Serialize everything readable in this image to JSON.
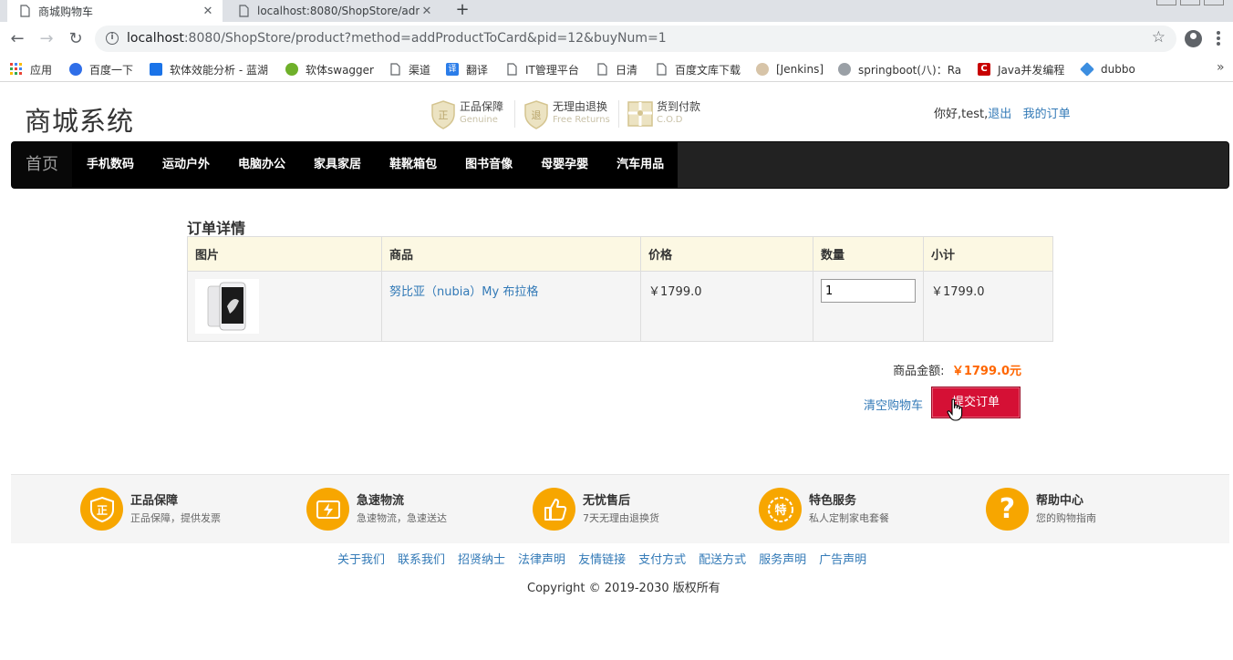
{
  "browser": {
    "tabs": [
      {
        "title": "商城购物车",
        "active": true
      },
      {
        "title": "localhost:8080/ShopStore/adn",
        "active": false
      }
    ],
    "url_host": "localhost",
    "url_rest": ":8080/ShopStore/product?method=addProductToCard&pid=12&buyNum=1",
    "bookmarks": [
      {
        "label": "应用",
        "icon": "apps-grid-icon",
        "color": "#e94235"
      },
      {
        "label": "百度一下",
        "icon": "baidu-paw-icon",
        "color": "#2f6ee8"
      },
      {
        "label": "软体效能分析 - 蓝湖",
        "icon": "lanhu-icon",
        "color": "#1a73e8"
      },
      {
        "label": "软体swagger",
        "icon": "swagger-icon",
        "color": "#6fb02a"
      },
      {
        "label": "渠道",
        "icon": "page-icon",
        "color": "#ffffff"
      },
      {
        "label": "翻译",
        "icon": "translate-icon",
        "color": "#2b7de9"
      },
      {
        "label": "IT管理平台",
        "icon": "page-icon",
        "color": "#ffffff"
      },
      {
        "label": "日清",
        "icon": "page-icon",
        "color": "#ffffff"
      },
      {
        "label": "百度文库下载",
        "icon": "page-icon",
        "color": "#ffffff"
      },
      {
        "label": "[Jenkins]",
        "icon": "jenkins-icon",
        "color": "#d7c4a8"
      },
      {
        "label": "springboot(八)：Ra",
        "icon": "blog-icon",
        "color": "#9aa0a6"
      },
      {
        "label": "Java并发编程",
        "icon": "csdn-icon",
        "color": "#c80000"
      },
      {
        "label": "dubbo",
        "icon": "dubbo-icon",
        "color": "#3c8ee0"
      }
    ],
    "bookmarks_more": "»"
  },
  "header": {
    "logo": "商城系统",
    "promises": [
      {
        "title": "正品保障",
        "sub": "Genuine",
        "icon": "genuine-shield-icon"
      },
      {
        "title": "无理由退换",
        "sub": "Free Returns",
        "icon": "returns-shield-icon"
      },
      {
        "title": "货到付款",
        "sub": "C.O.D",
        "icon": "cod-gift-icon"
      }
    ],
    "greeting": "你好,test,",
    "logout": "退出",
    "orders": "我的订单"
  },
  "nav": {
    "home": "首页",
    "categories": [
      "手机数码",
      "运动户外",
      "电脑办公",
      "家具家居",
      "鞋靴箱包",
      "图书音像",
      "母婴孕婴",
      "汽车用品"
    ]
  },
  "cart": {
    "title": "订单详情",
    "headers": [
      "图片",
      "商品",
      "价格",
      "数量",
      "小计"
    ],
    "items": [
      {
        "product": "努比亚（nubia）My 布拉格",
        "price": "￥1799.0",
        "quantity": "1",
        "subtotal": "￥1799.0"
      }
    ],
    "total_label": "商品金额:",
    "total_value": "￥1799.0元",
    "clear_label": "清空购物车",
    "submit_label": "提交订单"
  },
  "footer": {
    "features": [
      {
        "title": "正品保障",
        "desc": "正品保障，提供发票",
        "glyph": "正",
        "icon": "genuine-badge-icon"
      },
      {
        "title": "急速物流",
        "desc": "急速物流，急速送达",
        "glyph": "⚡",
        "icon": "fast-delivery-icon"
      },
      {
        "title": "无忧售后",
        "desc": "7天无理由退换货",
        "glyph": "👍",
        "icon": "thumbs-up-icon"
      },
      {
        "title": "特色服务",
        "desc": "私人定制家电套餐",
        "glyph": "特",
        "icon": "special-service-icon"
      },
      {
        "title": "帮助中心",
        "desc": "您的购物指南",
        "glyph": "?",
        "icon": "help-icon"
      }
    ],
    "links": [
      "关于我们",
      "联系我们",
      "招贤纳士",
      "法律声明",
      "友情链接",
      "支付方式",
      "配送方式",
      "服务声明",
      "广告声明"
    ],
    "copyright": "Copyright © 2019-2030 版权所有"
  }
}
